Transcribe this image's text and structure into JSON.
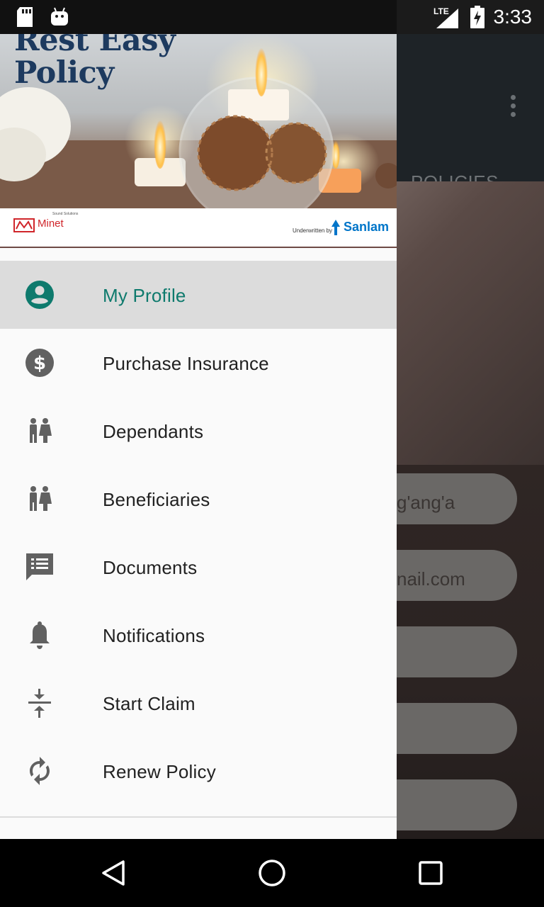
{
  "status_bar": {
    "time": "3:33",
    "network": "LTE",
    "icons": [
      "sd-card-icon",
      "android-debug-icon",
      "signal-icon",
      "battery-charging-icon"
    ]
  },
  "background_app": {
    "tab_label": "POLICIES",
    "field_values": [
      "g'ang'a",
      "nail.com"
    ]
  },
  "drawer": {
    "header": {
      "title_line1": "Rest Easy",
      "title_line2": "Policy",
      "minet_name": "Minet",
      "minet_tagline": "Sound Solutions",
      "underwritten_by": "Underwritten by",
      "sanlam_name": "Sanlam"
    },
    "items": [
      {
        "label": "My Profile",
        "icon": "account-circle-icon",
        "active": true
      },
      {
        "label": "Purchase Insurance",
        "icon": "dollar-circle-icon",
        "active": false
      },
      {
        "label": "Dependants",
        "icon": "people-icon",
        "active": false
      },
      {
        "label": "Beneficiaries",
        "icon": "people-icon",
        "active": false
      },
      {
        "label": "Documents",
        "icon": "list-comment-icon",
        "active": false
      },
      {
        "label": "Notifications",
        "icon": "bell-icon",
        "active": false
      },
      {
        "label": "Start Claim",
        "icon": "compress-arrows-icon",
        "active": false
      },
      {
        "label": "Renew Policy",
        "icon": "sync-icon",
        "active": false
      }
    ]
  },
  "colors": {
    "accent": "#0e7a6d",
    "drawer_bg": "#fafafa",
    "active_item_bg": "#dcdcdc",
    "icon_gray": "#616161",
    "toolbar": "#1e2327"
  }
}
